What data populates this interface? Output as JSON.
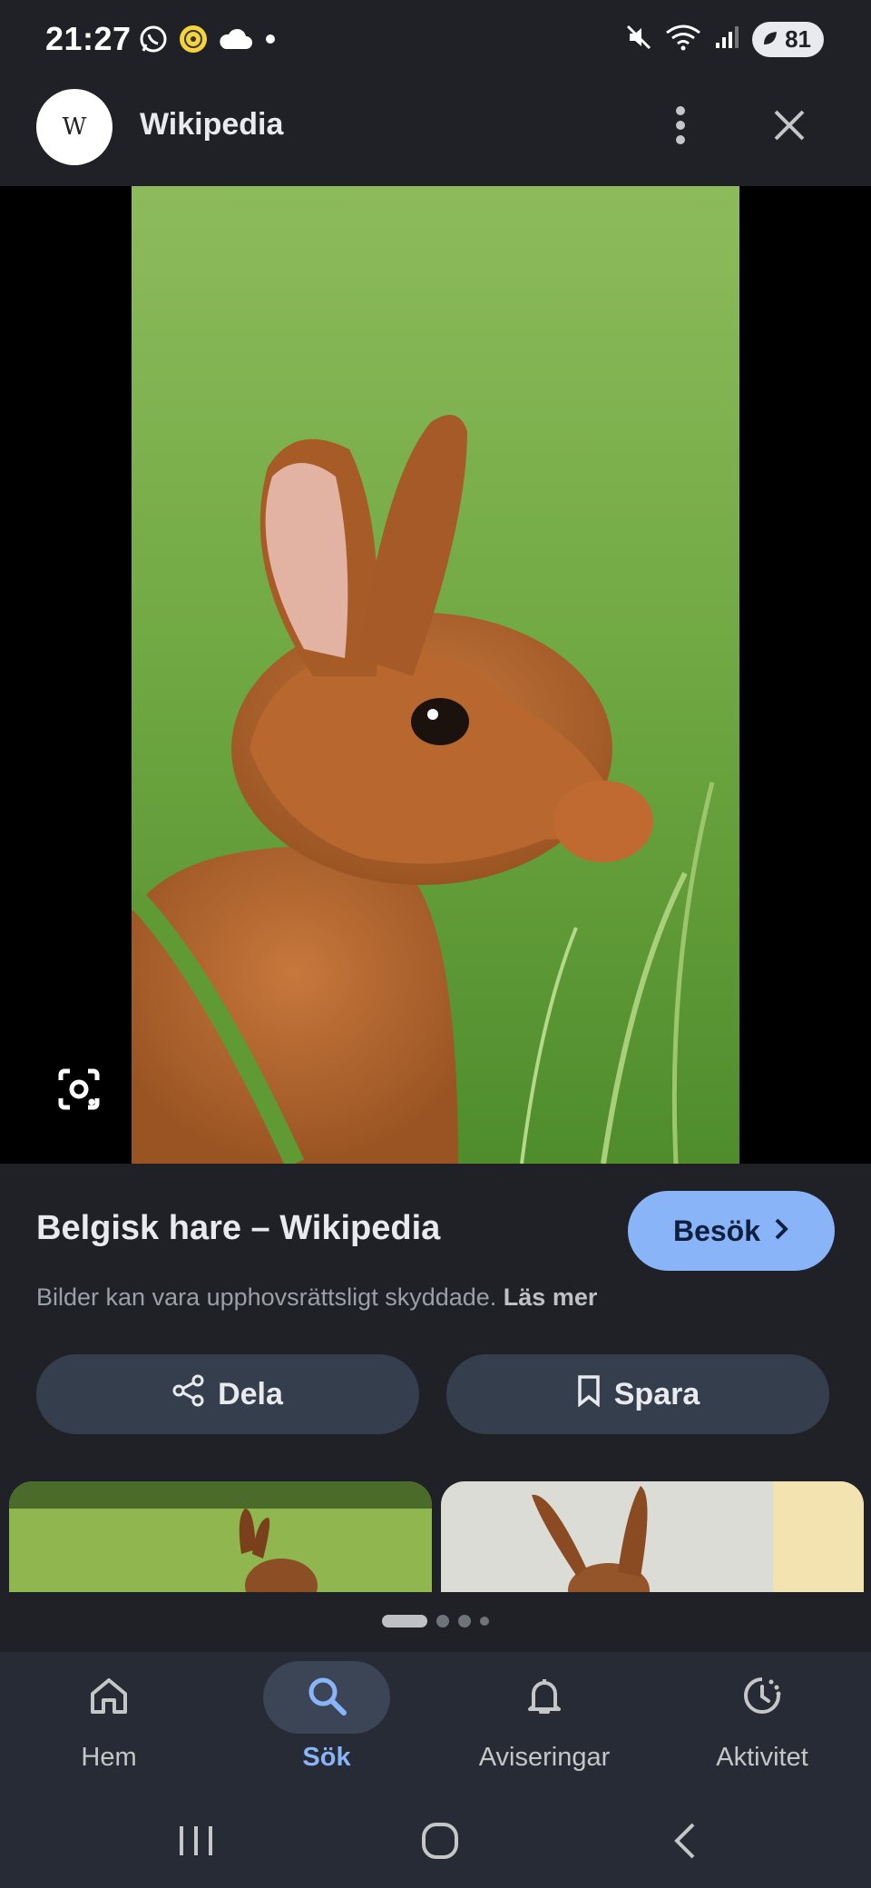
{
  "status_bar": {
    "time": "21:27",
    "left_icons": [
      "whatsapp-icon",
      "app-notification-icon",
      "cloud-icon",
      "dot-icon"
    ],
    "right_icons": [
      "mute-icon",
      "wifi-icon",
      "signal-icon"
    ],
    "battery": "81"
  },
  "header": {
    "logo_letter": "W",
    "site_name": "Wikipedia"
  },
  "result": {
    "title": "Belgisk hare – Wikipedia",
    "visit_label": "Besök",
    "copyright_text": "Bilder kan vara upphovsrättsligt skyddade.",
    "read_more": "Läs mer",
    "share_label": "Dela",
    "save_label": "Spara"
  },
  "pager": {
    "pages": 4,
    "active": 0
  },
  "bottom_nav": {
    "items": [
      {
        "label": "Hem",
        "icon": "home-icon"
      },
      {
        "label": "Sök",
        "icon": "search-icon"
      },
      {
        "label": "Aviseringar",
        "icon": "bell-icon"
      },
      {
        "label": "Aktivitet",
        "icon": "activity-icon"
      }
    ],
    "active_index": 1
  },
  "colors": {
    "background": "#1f2127",
    "accent": "#8ab4f8",
    "button": "#353e4d",
    "nav_background": "#262b36"
  }
}
